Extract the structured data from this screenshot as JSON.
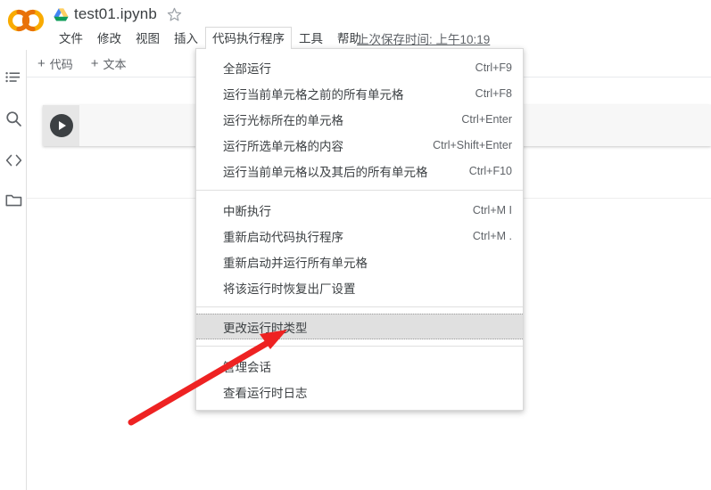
{
  "header": {
    "logo_icon": "colab-logo-icon",
    "drive_icon": "google-drive-icon",
    "doc_title": "test01.ipynb",
    "star_icon": "star-outline-icon",
    "save_status": "上次保存时间: 上午10:19"
  },
  "menubar": {
    "items": [
      {
        "label": "文件",
        "active": false
      },
      {
        "label": "修改",
        "active": false
      },
      {
        "label": "视图",
        "active": false
      },
      {
        "label": "插入",
        "active": false
      },
      {
        "label": "代码执行程序",
        "active": true
      },
      {
        "label": "工具",
        "active": false
      },
      {
        "label": "帮助",
        "active": false
      }
    ]
  },
  "sidebar": {
    "items": [
      {
        "name": "table-of-contents-icon",
        "label": "目录"
      },
      {
        "name": "search-icon",
        "label": "查找和替换"
      },
      {
        "name": "code-snippets-icon",
        "label": "代码段"
      },
      {
        "name": "files-folder-icon",
        "label": "文件"
      }
    ]
  },
  "toolbar": {
    "add_code_label": "代码",
    "add_text_label": "文本",
    "plus": "+"
  },
  "notebook": {
    "cell": {
      "run_button_name": "run-cell-button",
      "content": ""
    }
  },
  "runtime_menu": {
    "groups": [
      {
        "items": [
          {
            "label": "全部运行",
            "shortcut": "Ctrl+F9",
            "highlighted": false
          },
          {
            "label": "运行当前单元格之前的所有单元格",
            "shortcut": "Ctrl+F8",
            "highlighted": false
          },
          {
            "label": "运行光标所在的单元格",
            "shortcut": "Ctrl+Enter",
            "highlighted": false
          },
          {
            "label": "运行所选单元格的内容",
            "shortcut": "Ctrl+Shift+Enter",
            "highlighted": false
          },
          {
            "label": "运行当前单元格以及其后的所有单元格",
            "shortcut": "Ctrl+F10",
            "highlighted": false
          }
        ]
      },
      {
        "items": [
          {
            "label": "中断执行",
            "shortcut": "Ctrl+M I",
            "highlighted": false
          },
          {
            "label": "重新启动代码执行程序",
            "shortcut": "Ctrl+M .",
            "highlighted": false
          },
          {
            "label": "重新启动并运行所有单元格",
            "shortcut": "",
            "highlighted": false
          },
          {
            "label": "将该运行时恢复出厂设置",
            "shortcut": "",
            "highlighted": false
          }
        ]
      },
      {
        "items": [
          {
            "label": "更改运行时类型",
            "shortcut": "",
            "highlighted": true
          }
        ]
      },
      {
        "items": [
          {
            "label": "管理会话",
            "shortcut": "",
            "highlighted": false
          },
          {
            "label": "查看运行时日志",
            "shortcut": "",
            "highlighted": false
          }
        ]
      }
    ]
  },
  "annotation": {
    "arrow_color": "#ee2222",
    "arrow_name": "red-pointer-arrow"
  },
  "colors": {
    "accent_orange": "#f9ab00",
    "text_primary": "#3c4043",
    "text_secondary": "#5f6368",
    "highlight_bg": "#e0e0e0"
  }
}
